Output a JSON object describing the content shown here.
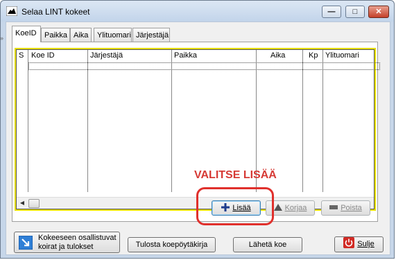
{
  "window": {
    "title": "Selaa LINT kokeet"
  },
  "window_controls": {
    "minimize": "—",
    "maximize": "□",
    "close": "✕"
  },
  "tabs": [
    {
      "label": "KoeID",
      "active": true
    },
    {
      "label": "Paikka",
      "active": false
    },
    {
      "label": "Aika",
      "active": false
    },
    {
      "label": "Ylituomari",
      "active": false
    },
    {
      "label": "Järjestäjä",
      "active": false
    }
  ],
  "grid": {
    "columns": [
      "S",
      "Koe ID",
      "Järjestäjä",
      "Paikka",
      "Aika",
      "Kp",
      "Ylituomari"
    ],
    "row_marker": "»",
    "scroll_left": "◀",
    "scroll_right": "▶"
  },
  "actions": {
    "add": {
      "icon": "plus-icon",
      "label": "Lisää"
    },
    "edit": {
      "icon": "triangle-up-icon",
      "label": "Korjaa"
    },
    "delete": {
      "icon": "minus-icon",
      "label": "Poista"
    }
  },
  "footer": {
    "participants_line1": "Kokeeseen osallistuvat",
    "participants_line2": "koirat ja tulokset",
    "print": "Tulosta koepöytäkirja",
    "send": "Lähetä koe",
    "close": "Sulje"
  },
  "annotation": {
    "text": "VALITSE LISÄÄ",
    "color": "#d63a35"
  }
}
